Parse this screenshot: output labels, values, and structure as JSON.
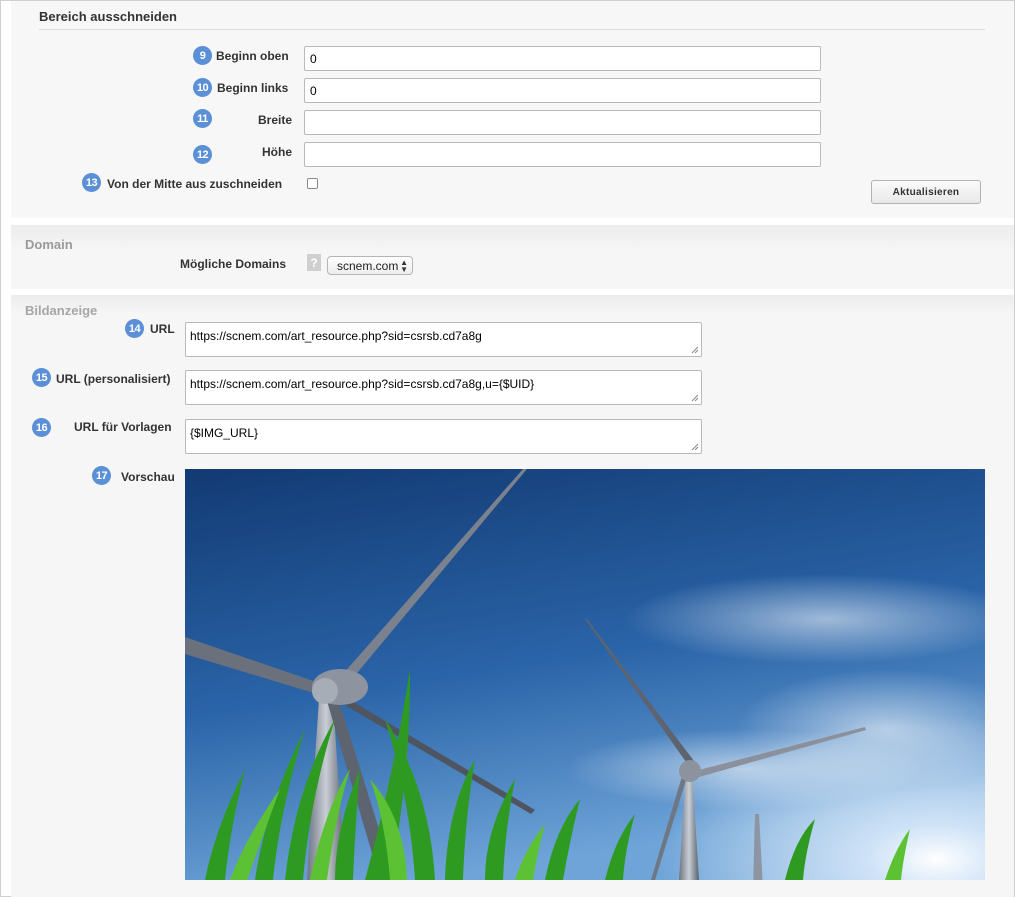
{
  "crop": {
    "title": "Bereich ausschneiden",
    "fields": [
      {
        "num": "9",
        "label": "Beginn oben",
        "value": "0"
      },
      {
        "num": "10",
        "label": "Beginn links",
        "value": "0"
      },
      {
        "num": "11",
        "label": "Breite",
        "value": ""
      },
      {
        "num": "12",
        "label": "Höhe",
        "value": ""
      }
    ],
    "center": {
      "num": "13",
      "label": "Von der Mitte aus zuschneiden",
      "checked": false
    },
    "update_label": "Aktualisieren"
  },
  "domain": {
    "title": "Domain",
    "label": "Mögliche Domains",
    "help": "?",
    "selected": "scnem.com"
  },
  "image": {
    "title": "Bildanzeige",
    "url": {
      "num": "14",
      "label": "URL",
      "value": "https://scnem.com/art_resource.php?sid=csrsb.cd7a8g"
    },
    "url_personal": {
      "num": "15",
      "label": "URL (personalisiert)",
      "value": "https://scnem.com/art_resource.php?sid=csrsb.cd7a8g,u={$UID}"
    },
    "url_template": {
      "num": "16",
      "label": "URL für Vorlagen",
      "value": "{$IMG_URL}"
    },
    "preview": {
      "num": "17",
      "label": "Vorschau"
    }
  },
  "colors": {
    "badge": "#5b8fd6",
    "sky_top": "#143f7a",
    "sky_bottom": "#4a87c8",
    "grass": "#2f9a24"
  }
}
